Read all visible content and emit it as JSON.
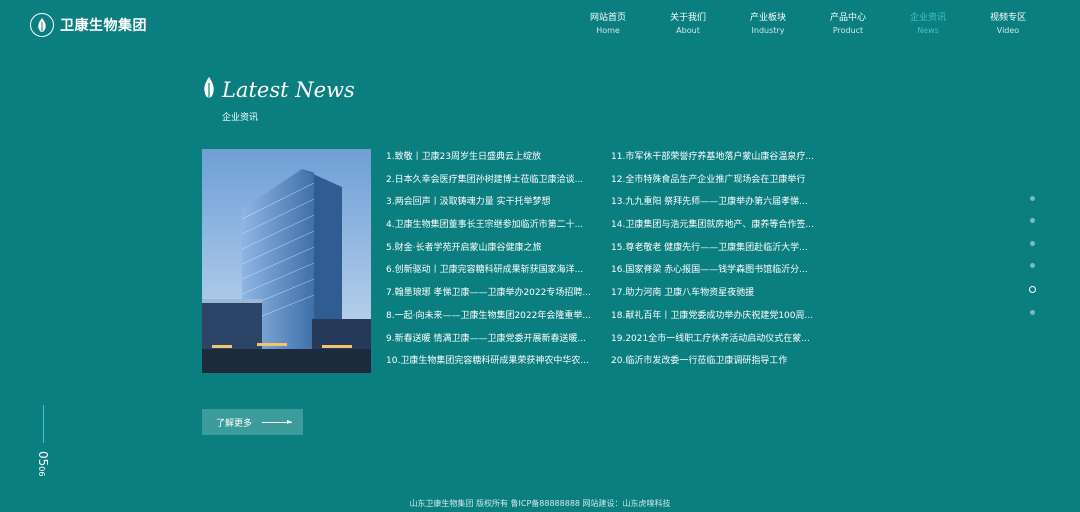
{
  "brand": {
    "name": "卫康生物集团"
  },
  "nav": [
    {
      "cn": "网站首页",
      "en": "Home",
      "active": false
    },
    {
      "cn": "关于我们",
      "en": "About",
      "active": false
    },
    {
      "cn": "产业板块",
      "en": "Industry",
      "active": false
    },
    {
      "cn": "产品中心",
      "en": "Product",
      "active": false
    },
    {
      "cn": "企业资讯",
      "en": "News",
      "active": true
    },
    {
      "cn": "视频专区",
      "en": "Video",
      "active": false
    }
  ],
  "section": {
    "title": "Latest News",
    "subtitle": "企业资讯"
  },
  "news_left": [
    "1.致敬丨卫康23周岁生日盛典云上绽放",
    "2.日本久幸会医疗集团孙树建博士莅临卫康洽谈...",
    "3.两会回声丨汲取铸魂力量 实干托举梦想",
    "4.卫康生物集团董事长王宗继参加临沂市第二十...",
    "5.财金·长者学苑开启蒙山康谷健康之旅",
    "6.创新驱动丨卫康完容糖科研成果斩获国家海洋...",
    "7.翰墨琅琊 孝悌卫康——卫康举办2022专场招聘...",
    "8.一起·向未来——卫康生物集团2022年会隆重举...",
    "9.新春送暖 情满卫康——卫康党委开展新春送暖...",
    "10.卫康生物集团完容糖科研成果荣获神农中华农..."
  ],
  "news_right": [
    "11.市军休干部荣誉疗养基地落户蒙山康谷温泉疗...",
    "12.全市特殊食品生产企业推广现场会在卫康举行",
    "13.九九重阳 祭拜先师——卫康举办第六届孝悌...",
    "14.卫康集团与浩元集团就房地产、康养等合作签...",
    "15.尊老敬老 健康先行——卫康集团赴临沂大学...",
    "16.国家脊梁 赤心报国——钱学森图书馆临沂分...",
    "17.助力河南 卫康八车物资星夜驰援",
    "18.献礼百年丨卫康党委成功举办庆祝建党100周...",
    "19.2021全市一线职工疗休养活动启动仪式在蒙...",
    "20.临沂市发改委一行莅临卫康调研指导工作"
  ],
  "more_button": {
    "label": "了解更多"
  },
  "side_dots": {
    "count": 6,
    "active_index": 4
  },
  "pager": {
    "current": "05",
    "total": "06"
  },
  "footer": {
    "text": "山东卫康生物集团 版权所有 鲁ICP备88888888 网站建设：山东虎嗅科技"
  },
  "colors": {
    "background": "#0b7e80",
    "accent": "#3ec6c6",
    "button": "#3b9c9b"
  }
}
